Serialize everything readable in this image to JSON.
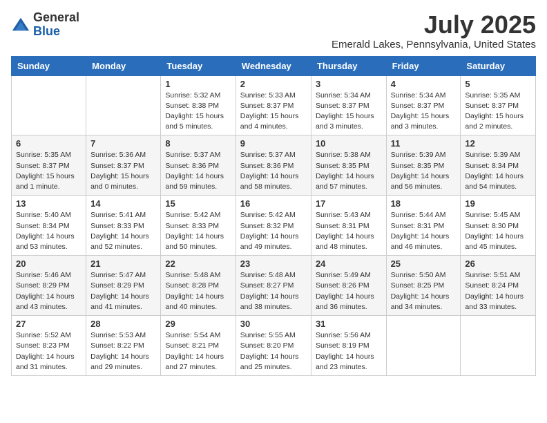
{
  "logo": {
    "general": "General",
    "blue": "Blue"
  },
  "title": {
    "month_year": "July 2025",
    "location": "Emerald Lakes, Pennsylvania, United States"
  },
  "weekdays": [
    "Sunday",
    "Monday",
    "Tuesday",
    "Wednesday",
    "Thursday",
    "Friday",
    "Saturday"
  ],
  "weeks": [
    [
      {
        "day": "",
        "info": ""
      },
      {
        "day": "",
        "info": ""
      },
      {
        "day": "1",
        "info": "Sunrise: 5:32 AM\nSunset: 8:38 PM\nDaylight: 15 hours\nand 5 minutes."
      },
      {
        "day": "2",
        "info": "Sunrise: 5:33 AM\nSunset: 8:37 PM\nDaylight: 15 hours\nand 4 minutes."
      },
      {
        "day": "3",
        "info": "Sunrise: 5:34 AM\nSunset: 8:37 PM\nDaylight: 15 hours\nand 3 minutes."
      },
      {
        "day": "4",
        "info": "Sunrise: 5:34 AM\nSunset: 8:37 PM\nDaylight: 15 hours\nand 3 minutes."
      },
      {
        "day": "5",
        "info": "Sunrise: 5:35 AM\nSunset: 8:37 PM\nDaylight: 15 hours\nand 2 minutes."
      }
    ],
    [
      {
        "day": "6",
        "info": "Sunrise: 5:35 AM\nSunset: 8:37 PM\nDaylight: 15 hours\nand 1 minute."
      },
      {
        "day": "7",
        "info": "Sunrise: 5:36 AM\nSunset: 8:37 PM\nDaylight: 15 hours\nand 0 minutes."
      },
      {
        "day": "8",
        "info": "Sunrise: 5:37 AM\nSunset: 8:36 PM\nDaylight: 14 hours\nand 59 minutes."
      },
      {
        "day": "9",
        "info": "Sunrise: 5:37 AM\nSunset: 8:36 PM\nDaylight: 14 hours\nand 58 minutes."
      },
      {
        "day": "10",
        "info": "Sunrise: 5:38 AM\nSunset: 8:35 PM\nDaylight: 14 hours\nand 57 minutes."
      },
      {
        "day": "11",
        "info": "Sunrise: 5:39 AM\nSunset: 8:35 PM\nDaylight: 14 hours\nand 56 minutes."
      },
      {
        "day": "12",
        "info": "Sunrise: 5:39 AM\nSunset: 8:34 PM\nDaylight: 14 hours\nand 54 minutes."
      }
    ],
    [
      {
        "day": "13",
        "info": "Sunrise: 5:40 AM\nSunset: 8:34 PM\nDaylight: 14 hours\nand 53 minutes."
      },
      {
        "day": "14",
        "info": "Sunrise: 5:41 AM\nSunset: 8:33 PM\nDaylight: 14 hours\nand 52 minutes."
      },
      {
        "day": "15",
        "info": "Sunrise: 5:42 AM\nSunset: 8:33 PM\nDaylight: 14 hours\nand 50 minutes."
      },
      {
        "day": "16",
        "info": "Sunrise: 5:42 AM\nSunset: 8:32 PM\nDaylight: 14 hours\nand 49 minutes."
      },
      {
        "day": "17",
        "info": "Sunrise: 5:43 AM\nSunset: 8:31 PM\nDaylight: 14 hours\nand 48 minutes."
      },
      {
        "day": "18",
        "info": "Sunrise: 5:44 AM\nSunset: 8:31 PM\nDaylight: 14 hours\nand 46 minutes."
      },
      {
        "day": "19",
        "info": "Sunrise: 5:45 AM\nSunset: 8:30 PM\nDaylight: 14 hours\nand 45 minutes."
      }
    ],
    [
      {
        "day": "20",
        "info": "Sunrise: 5:46 AM\nSunset: 8:29 PM\nDaylight: 14 hours\nand 43 minutes."
      },
      {
        "day": "21",
        "info": "Sunrise: 5:47 AM\nSunset: 8:29 PM\nDaylight: 14 hours\nand 41 minutes."
      },
      {
        "day": "22",
        "info": "Sunrise: 5:48 AM\nSunset: 8:28 PM\nDaylight: 14 hours\nand 40 minutes."
      },
      {
        "day": "23",
        "info": "Sunrise: 5:48 AM\nSunset: 8:27 PM\nDaylight: 14 hours\nand 38 minutes."
      },
      {
        "day": "24",
        "info": "Sunrise: 5:49 AM\nSunset: 8:26 PM\nDaylight: 14 hours\nand 36 minutes."
      },
      {
        "day": "25",
        "info": "Sunrise: 5:50 AM\nSunset: 8:25 PM\nDaylight: 14 hours\nand 34 minutes."
      },
      {
        "day": "26",
        "info": "Sunrise: 5:51 AM\nSunset: 8:24 PM\nDaylight: 14 hours\nand 33 minutes."
      }
    ],
    [
      {
        "day": "27",
        "info": "Sunrise: 5:52 AM\nSunset: 8:23 PM\nDaylight: 14 hours\nand 31 minutes."
      },
      {
        "day": "28",
        "info": "Sunrise: 5:53 AM\nSunset: 8:22 PM\nDaylight: 14 hours\nand 29 minutes."
      },
      {
        "day": "29",
        "info": "Sunrise: 5:54 AM\nSunset: 8:21 PM\nDaylight: 14 hours\nand 27 minutes."
      },
      {
        "day": "30",
        "info": "Sunrise: 5:55 AM\nSunset: 8:20 PM\nDaylight: 14 hours\nand 25 minutes."
      },
      {
        "day": "31",
        "info": "Sunrise: 5:56 AM\nSunset: 8:19 PM\nDaylight: 14 hours\nand 23 minutes."
      },
      {
        "day": "",
        "info": ""
      },
      {
        "day": "",
        "info": ""
      }
    ]
  ]
}
